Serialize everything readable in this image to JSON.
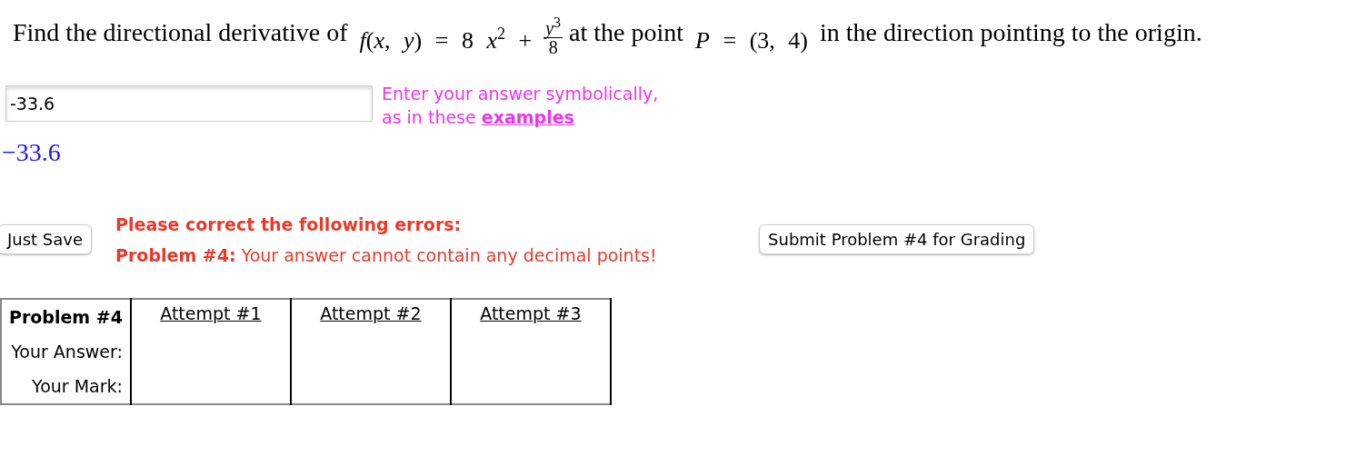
{
  "question": {
    "parts": [
      {
        "kind": "text",
        "text": "Find the directional derivative of"
      },
      {
        "kind": "math",
        "text": "*f*(*x*, *y*) = 8 *x*$^{2}$ +"
      },
      {
        "kind": "frac",
        "num": "*y*$^{3}$",
        "den": "8"
      },
      {
        "kind": "text",
        "text": "at the point"
      },
      {
        "kind": "math",
        "text": "*P* = (3, 4)"
      },
      {
        "kind": "text",
        "text": "in the direction pointing to the origin."
      }
    ]
  },
  "answer": {
    "value": "-33.6",
    "hint": "Enter your answer symbolically,",
    "hint_line2": "as in these",
    "hint_link": "examples",
    "preview": "−33.6"
  },
  "buttons": {
    "save": "Just Save",
    "submit": "Submit Problem #4 for Grading"
  },
  "errors": {
    "title": "Please correct the following errors:",
    "label": "Problem #4:",
    "message": "Your answer cannot contain any decimal points!"
  },
  "attempts_table": {
    "corner": "Problem #4",
    "columns": [
      "Attempt #1",
      "Attempt #2",
      "Attempt #3"
    ],
    "row_labels": [
      "Your Answer:",
      "Your Mark:"
    ]
  }
}
